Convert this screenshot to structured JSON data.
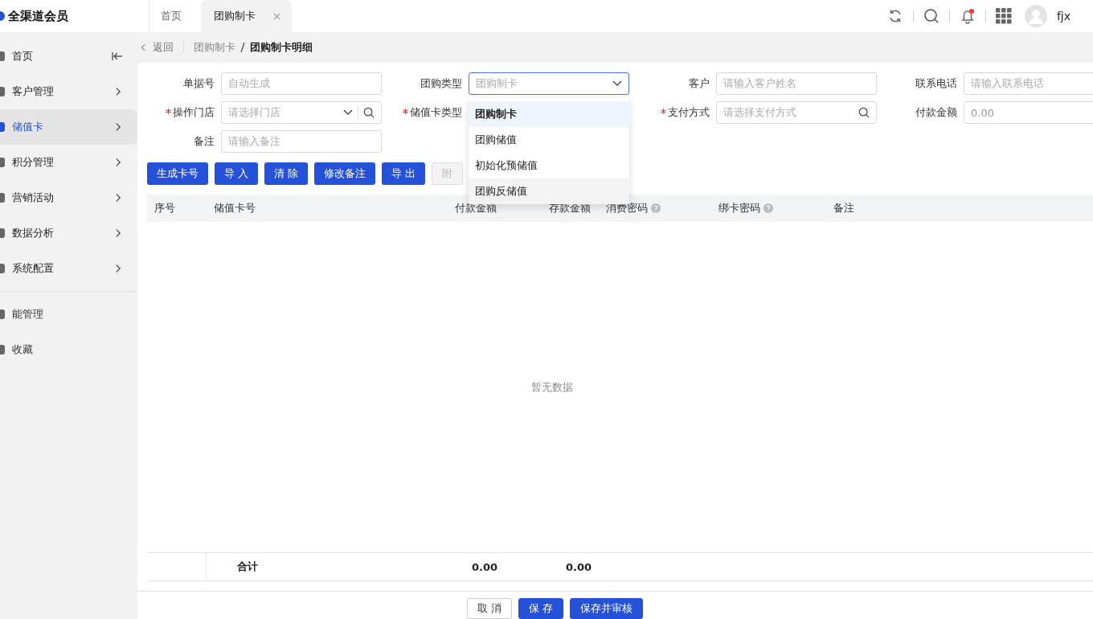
{
  "app": {
    "title": "全渠道会员",
    "user": "fjx",
    "has_notification": true
  },
  "tabs": [
    {
      "label": "首页",
      "selected": false,
      "closable": false
    },
    {
      "label": "团购制卡",
      "selected": true,
      "closable": true
    }
  ],
  "sidebar": {
    "items": [
      {
        "label": "首页",
        "selected": false,
        "expandable": false
      },
      {
        "label": "客户管理",
        "selected": false,
        "expandable": true
      },
      {
        "label": "储值卡",
        "selected": true,
        "expandable": true
      },
      {
        "label": "积分管理",
        "selected": false,
        "expandable": true
      },
      {
        "label": "营销活动",
        "selected": false,
        "expandable": true
      },
      {
        "label": "数据分析",
        "selected": false,
        "expandable": true
      },
      {
        "label": "系统配置",
        "selected": false,
        "expandable": true
      }
    ],
    "extra_items": [
      {
        "label": "能管理"
      },
      {
        "label": "收藏"
      }
    ]
  },
  "breadcrumb": {
    "back": "返回",
    "path": [
      "团购制卡",
      "团购制卡明细"
    ]
  },
  "form": {
    "fields": [
      {
        "label": "单据号",
        "required": false,
        "kind": "text",
        "placeholder": "自动生成",
        "focused": false
      },
      {
        "label": "团购类型",
        "required": false,
        "kind": "select",
        "placeholder": "团购制卡",
        "focused": true
      },
      {
        "label": "客户",
        "required": false,
        "kind": "text",
        "placeholder": "请输入客户姓名",
        "focused": false
      },
      {
        "label": "联系电话",
        "required": false,
        "kind": "text",
        "placeholder": "请输入联系电话",
        "focused": false
      },
      {
        "label": "操作门店",
        "required": true,
        "kind": "select-search",
        "placeholder": "请选择门店",
        "focused": false
      },
      {
        "label": "储值卡类型",
        "required": true,
        "kind": "hidden"
      },
      {
        "label": "支付方式",
        "required": true,
        "kind": "search",
        "placeholder": "请选择支付方式",
        "focused": false
      },
      {
        "label": "付款金额",
        "required": false,
        "kind": "text",
        "value": "0.00",
        "focused": false
      },
      {
        "label": "备注",
        "required": false,
        "kind": "text",
        "placeholder": "请输入备注",
        "focused": false
      }
    ]
  },
  "dropdown": {
    "options": [
      {
        "label": "团购制卡",
        "selected": true,
        "hovered": false
      },
      {
        "label": "团购储值",
        "selected": false,
        "hovered": false
      },
      {
        "label": "初始化预储值",
        "selected": false,
        "hovered": false
      },
      {
        "label": "团购反储值",
        "selected": false,
        "hovered": true
      }
    ]
  },
  "toolbar": [
    {
      "label": "生成卡号",
      "disabled": false
    },
    {
      "label": "导 入",
      "disabled": false
    },
    {
      "label": "清 除",
      "disabled": false
    },
    {
      "label": "修改备注",
      "disabled": false
    },
    {
      "label": "导 出",
      "disabled": false
    },
    {
      "label": "附",
      "disabled": true
    }
  ],
  "table": {
    "columns": [
      {
        "label": "序号",
        "help": false
      },
      {
        "label": "储值卡号",
        "help": false
      },
      {
        "label": "付款金额",
        "help": false
      },
      {
        "label": "存款金额",
        "help": false
      },
      {
        "label": "消费密码",
        "help": true
      },
      {
        "label": "绑卡密码",
        "help": true
      },
      {
        "label": "备注",
        "help": false
      }
    ],
    "empty_text": "暂无数据",
    "summary": {
      "label": "合计",
      "pay_total": "0.00",
      "deposit_total": "0.00"
    }
  },
  "footer_buttons": [
    {
      "label": "取 消",
      "primary": false
    },
    {
      "label": "保 存",
      "primary": true
    },
    {
      "label": "保存并审核",
      "primary": true
    }
  ]
}
